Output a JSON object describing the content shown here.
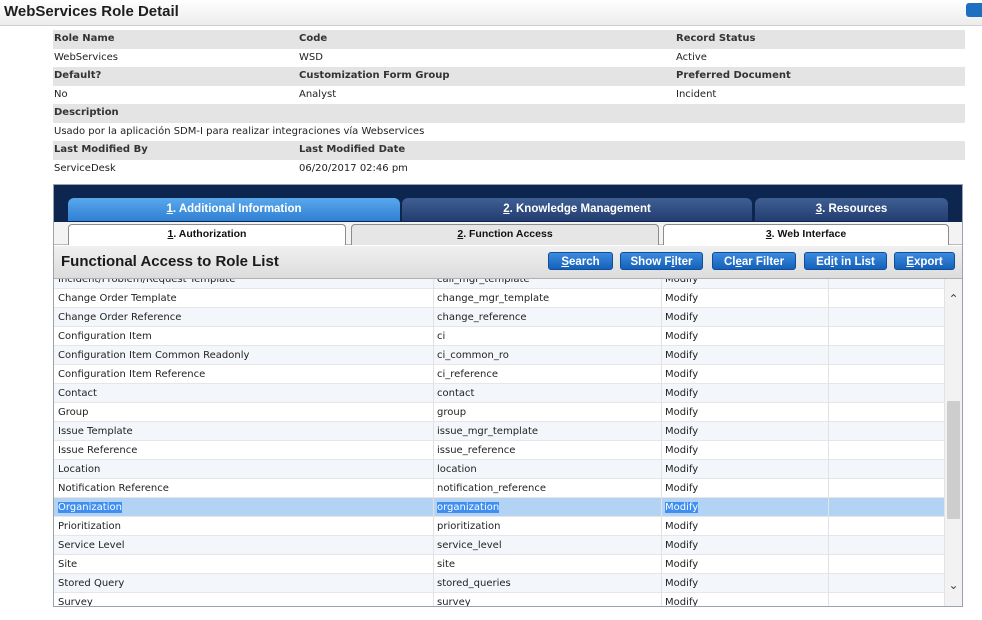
{
  "page": {
    "title": "WebServices Role Detail"
  },
  "detail": {
    "labels_row1": [
      "Role Name",
      "Code",
      "Record Status"
    ],
    "values_row1": [
      "WebServices",
      "WSD",
      "Active"
    ],
    "labels_row2": [
      "Default?",
      "Customization Form Group",
      "Preferred Document"
    ],
    "values_row2": [
      "No",
      "Analyst",
      "Incident"
    ],
    "label_description": "Description",
    "value_description": "Usado por la aplicación SDM-I para realizar integraciones vía Webservices",
    "labels_row4": [
      "Last Modified By",
      "Last Modified Date"
    ],
    "values_row4": [
      "ServiceDesk",
      "06/20/2017 02:46 pm"
    ]
  },
  "tabs_main": [
    {
      "num": "1",
      "label": ". Additional Information"
    },
    {
      "num": "2",
      "label": ". Knowledge Management"
    },
    {
      "num": "3",
      "label": ". Resources"
    }
  ],
  "tabs_sub": [
    {
      "num": "1",
      "label": ". Authorization"
    },
    {
      "num": "2",
      "label": ". Function Access"
    },
    {
      "num": "3",
      "label": ". Web Interface"
    }
  ],
  "list": {
    "title": "Functional Access to Role List",
    "buttons": {
      "search": {
        "u": "S",
        "rest": "earch"
      },
      "show_filter": {
        "pre": "Show F",
        "u": "i",
        "rest": "lter"
      },
      "clear_filter": {
        "pre": "Cl",
        "u": "e",
        "rest": "ar Filter"
      },
      "edit_in_list": {
        "pre": "Ed",
        "u": "i",
        "rest": "t in List"
      },
      "export": {
        "u": "E",
        "rest": "xport"
      }
    },
    "rows": [
      {
        "name": "Incident/Problem/Request Template",
        "code": "call_mgr_template",
        "access": "Modify"
      },
      {
        "name": "Change Order Template",
        "code": "change_mgr_template",
        "access": "Modify"
      },
      {
        "name": "Change Order Reference",
        "code": "change_reference",
        "access": "Modify"
      },
      {
        "name": "Configuration Item",
        "code": "ci",
        "access": "Modify"
      },
      {
        "name": "Configuration Item Common Readonly",
        "code": "ci_common_ro",
        "access": "Modify"
      },
      {
        "name": "Configuration Item Reference",
        "code": "ci_reference",
        "access": "Modify"
      },
      {
        "name": "Contact",
        "code": "contact",
        "access": "Modify"
      },
      {
        "name": "Group",
        "code": "group",
        "access": "Modify"
      },
      {
        "name": "Issue Template",
        "code": "issue_mgr_template",
        "access": "Modify"
      },
      {
        "name": "Issue Reference",
        "code": "issue_reference",
        "access": "Modify"
      },
      {
        "name": "Location",
        "code": "location",
        "access": "Modify"
      },
      {
        "name": "Notification Reference",
        "code": "notification_reference",
        "access": "Modify"
      },
      {
        "name": "Organization",
        "code": "organization",
        "access": "Modify",
        "selected": true
      },
      {
        "name": "Prioritization",
        "code": "prioritization",
        "access": "Modify"
      },
      {
        "name": "Service Level",
        "code": "service_level",
        "access": "Modify"
      },
      {
        "name": "Site",
        "code": "site",
        "access": "Modify"
      },
      {
        "name": "Stored Query",
        "code": "stored_queries",
        "access": "Modify"
      },
      {
        "name": "Survey",
        "code": "survey",
        "access": "Modify"
      }
    ]
  },
  "icons": {
    "scroll_up": "chevron-up-icon",
    "scroll_down": "chevron-down-icon"
  },
  "colors": {
    "tab_active": "#2f7fd4",
    "tab_inactive": "#233d70",
    "tabbar_bg": "#0d2650",
    "button": "#1560b8",
    "selection": "#3f8ef0"
  }
}
